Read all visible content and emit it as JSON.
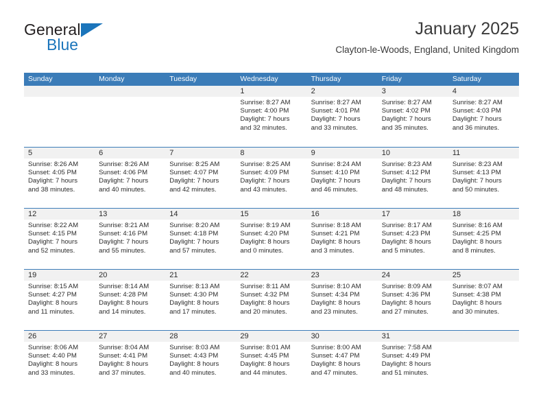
{
  "brand": {
    "name_part1": "General",
    "name_part2": "Blue",
    "triangle_color": "#1b75bb",
    "text_color": "#231f20"
  },
  "header": {
    "title": "January 2025",
    "location": "Clayton-le-Woods, England, United Kingdom"
  },
  "theme": {
    "header_bg": "#3b7cb8",
    "header_text": "#ffffff",
    "day_band_bg": "#f1f1f1",
    "row_divider": "#3b7cb8"
  },
  "calendar": {
    "weekdays": [
      "Sunday",
      "Monday",
      "Tuesday",
      "Wednesday",
      "Thursday",
      "Friday",
      "Saturday"
    ],
    "labels": {
      "sunrise": "Sunrise:",
      "sunset": "Sunset:",
      "daylight": "Daylight:"
    },
    "weeks": [
      [
        {
          "day": ""
        },
        {
          "day": ""
        },
        {
          "day": ""
        },
        {
          "day": "1",
          "sunrise": "Sunrise: 8:27 AM",
          "sunset": "Sunset: 4:00 PM",
          "daylight1": "Daylight: 7 hours",
          "daylight2": "and 32 minutes."
        },
        {
          "day": "2",
          "sunrise": "Sunrise: 8:27 AM",
          "sunset": "Sunset: 4:01 PM",
          "daylight1": "Daylight: 7 hours",
          "daylight2": "and 33 minutes."
        },
        {
          "day": "3",
          "sunrise": "Sunrise: 8:27 AM",
          "sunset": "Sunset: 4:02 PM",
          "daylight1": "Daylight: 7 hours",
          "daylight2": "and 35 minutes."
        },
        {
          "day": "4",
          "sunrise": "Sunrise: 8:27 AM",
          "sunset": "Sunset: 4:03 PM",
          "daylight1": "Daylight: 7 hours",
          "daylight2": "and 36 minutes."
        }
      ],
      [
        {
          "day": "5",
          "sunrise": "Sunrise: 8:26 AM",
          "sunset": "Sunset: 4:05 PM",
          "daylight1": "Daylight: 7 hours",
          "daylight2": "and 38 minutes."
        },
        {
          "day": "6",
          "sunrise": "Sunrise: 8:26 AM",
          "sunset": "Sunset: 4:06 PM",
          "daylight1": "Daylight: 7 hours",
          "daylight2": "and 40 minutes."
        },
        {
          "day": "7",
          "sunrise": "Sunrise: 8:25 AM",
          "sunset": "Sunset: 4:07 PM",
          "daylight1": "Daylight: 7 hours",
          "daylight2": "and 42 minutes."
        },
        {
          "day": "8",
          "sunrise": "Sunrise: 8:25 AM",
          "sunset": "Sunset: 4:09 PM",
          "daylight1": "Daylight: 7 hours",
          "daylight2": "and 43 minutes."
        },
        {
          "day": "9",
          "sunrise": "Sunrise: 8:24 AM",
          "sunset": "Sunset: 4:10 PM",
          "daylight1": "Daylight: 7 hours",
          "daylight2": "and 46 minutes."
        },
        {
          "day": "10",
          "sunrise": "Sunrise: 8:23 AM",
          "sunset": "Sunset: 4:12 PM",
          "daylight1": "Daylight: 7 hours",
          "daylight2": "and 48 minutes."
        },
        {
          "day": "11",
          "sunrise": "Sunrise: 8:23 AM",
          "sunset": "Sunset: 4:13 PM",
          "daylight1": "Daylight: 7 hours",
          "daylight2": "and 50 minutes."
        }
      ],
      [
        {
          "day": "12",
          "sunrise": "Sunrise: 8:22 AM",
          "sunset": "Sunset: 4:15 PM",
          "daylight1": "Daylight: 7 hours",
          "daylight2": "and 52 minutes."
        },
        {
          "day": "13",
          "sunrise": "Sunrise: 8:21 AM",
          "sunset": "Sunset: 4:16 PM",
          "daylight1": "Daylight: 7 hours",
          "daylight2": "and 55 minutes."
        },
        {
          "day": "14",
          "sunrise": "Sunrise: 8:20 AM",
          "sunset": "Sunset: 4:18 PM",
          "daylight1": "Daylight: 7 hours",
          "daylight2": "and 57 minutes."
        },
        {
          "day": "15",
          "sunrise": "Sunrise: 8:19 AM",
          "sunset": "Sunset: 4:20 PM",
          "daylight1": "Daylight: 8 hours",
          "daylight2": "and 0 minutes."
        },
        {
          "day": "16",
          "sunrise": "Sunrise: 8:18 AM",
          "sunset": "Sunset: 4:21 PM",
          "daylight1": "Daylight: 8 hours",
          "daylight2": "and 3 minutes."
        },
        {
          "day": "17",
          "sunrise": "Sunrise: 8:17 AM",
          "sunset": "Sunset: 4:23 PM",
          "daylight1": "Daylight: 8 hours",
          "daylight2": "and 5 minutes."
        },
        {
          "day": "18",
          "sunrise": "Sunrise: 8:16 AM",
          "sunset": "Sunset: 4:25 PM",
          "daylight1": "Daylight: 8 hours",
          "daylight2": "and 8 minutes."
        }
      ],
      [
        {
          "day": "19",
          "sunrise": "Sunrise: 8:15 AM",
          "sunset": "Sunset: 4:27 PM",
          "daylight1": "Daylight: 8 hours",
          "daylight2": "and 11 minutes."
        },
        {
          "day": "20",
          "sunrise": "Sunrise: 8:14 AM",
          "sunset": "Sunset: 4:28 PM",
          "daylight1": "Daylight: 8 hours",
          "daylight2": "and 14 minutes."
        },
        {
          "day": "21",
          "sunrise": "Sunrise: 8:13 AM",
          "sunset": "Sunset: 4:30 PM",
          "daylight1": "Daylight: 8 hours",
          "daylight2": "and 17 minutes."
        },
        {
          "day": "22",
          "sunrise": "Sunrise: 8:11 AM",
          "sunset": "Sunset: 4:32 PM",
          "daylight1": "Daylight: 8 hours",
          "daylight2": "and 20 minutes."
        },
        {
          "day": "23",
          "sunrise": "Sunrise: 8:10 AM",
          "sunset": "Sunset: 4:34 PM",
          "daylight1": "Daylight: 8 hours",
          "daylight2": "and 23 minutes."
        },
        {
          "day": "24",
          "sunrise": "Sunrise: 8:09 AM",
          "sunset": "Sunset: 4:36 PM",
          "daylight1": "Daylight: 8 hours",
          "daylight2": "and 27 minutes."
        },
        {
          "day": "25",
          "sunrise": "Sunrise: 8:07 AM",
          "sunset": "Sunset: 4:38 PM",
          "daylight1": "Daylight: 8 hours",
          "daylight2": "and 30 minutes."
        }
      ],
      [
        {
          "day": "26",
          "sunrise": "Sunrise: 8:06 AM",
          "sunset": "Sunset: 4:40 PM",
          "daylight1": "Daylight: 8 hours",
          "daylight2": "and 33 minutes."
        },
        {
          "day": "27",
          "sunrise": "Sunrise: 8:04 AM",
          "sunset": "Sunset: 4:41 PM",
          "daylight1": "Daylight: 8 hours",
          "daylight2": "and 37 minutes."
        },
        {
          "day": "28",
          "sunrise": "Sunrise: 8:03 AM",
          "sunset": "Sunset: 4:43 PM",
          "daylight1": "Daylight: 8 hours",
          "daylight2": "and 40 minutes."
        },
        {
          "day": "29",
          "sunrise": "Sunrise: 8:01 AM",
          "sunset": "Sunset: 4:45 PM",
          "daylight1": "Daylight: 8 hours",
          "daylight2": "and 44 minutes."
        },
        {
          "day": "30",
          "sunrise": "Sunrise: 8:00 AM",
          "sunset": "Sunset: 4:47 PM",
          "daylight1": "Daylight: 8 hours",
          "daylight2": "and 47 minutes."
        },
        {
          "day": "31",
          "sunrise": "Sunrise: 7:58 AM",
          "sunset": "Sunset: 4:49 PM",
          "daylight1": "Daylight: 8 hours",
          "daylight2": "and 51 minutes."
        },
        {
          "day": ""
        }
      ]
    ]
  }
}
